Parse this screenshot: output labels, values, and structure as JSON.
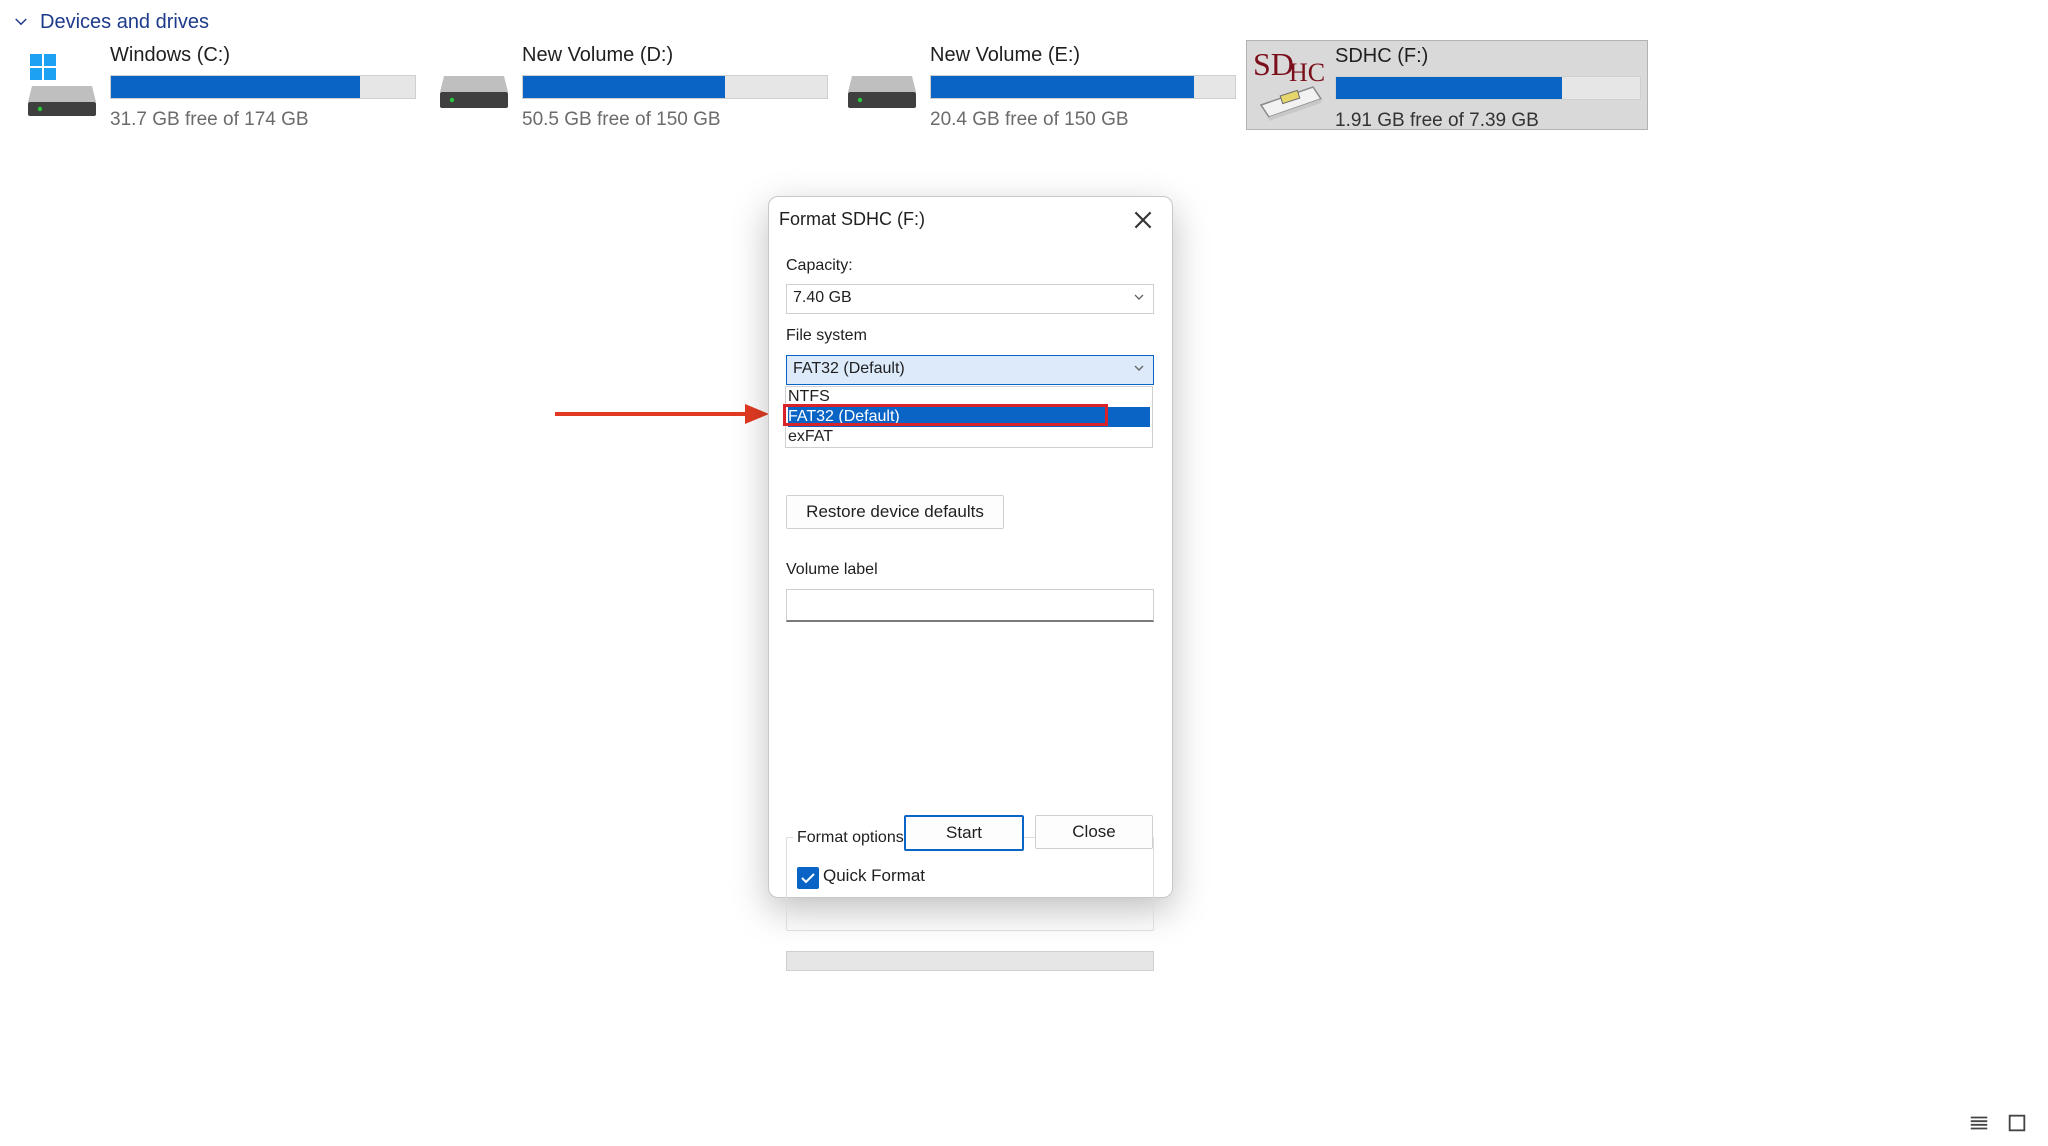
{
  "section": {
    "title": "Devices and drives"
  },
  "drives": [
    {
      "name": "Windows (C:)",
      "free_text": "31.7 GB free of 174 GB",
      "used_fraction": 0.818,
      "icon": "windows-drive-icon"
    },
    {
      "name": "New Volume (D:)",
      "free_text": "50.5 GB free of 150 GB",
      "used_fraction": 0.663,
      "icon": "hdd-icon"
    },
    {
      "name": "New Volume (E:)",
      "free_text": "20.4 GB free of 150 GB",
      "used_fraction": 0.864,
      "icon": "hdd-icon"
    },
    {
      "name": "SDHC (F:)",
      "free_text": "1.91 GB free of 7.39 GB",
      "used_fraction": 0.742,
      "icon": "sdhc-card-icon",
      "selected": true
    }
  ],
  "dialog": {
    "title": "Format SDHC (F:)",
    "capacity": {
      "label": "Capacity:",
      "value": "7.40 GB"
    },
    "file_system": {
      "label": "File system",
      "value": "FAT32 (Default)",
      "options": [
        "NTFS",
        "FAT32 (Default)",
        "exFAT"
      ],
      "selected_option_index": 1
    },
    "restore_label": "Restore device defaults",
    "volume_label": {
      "label": "Volume label",
      "value": ""
    },
    "format_options": {
      "title": "Format options",
      "quick_format_label": "Quick Format",
      "quick_format_checked": true
    },
    "buttons": {
      "start": "Start",
      "close": "Close"
    }
  },
  "colors": {
    "accent": "#0a64c5",
    "highlight": "#d8232a",
    "arrow": "#e23a22",
    "section_link": "#1e3a8a"
  },
  "icons": [
    "chevron-down-icon",
    "windows-drive-icon",
    "hdd-icon",
    "sdhc-card-icon",
    "close-icon",
    "dropdown-caret-icon",
    "checkmark-icon",
    "red-arrow-icon",
    "details-view-icon",
    "tiles-view-icon"
  ]
}
